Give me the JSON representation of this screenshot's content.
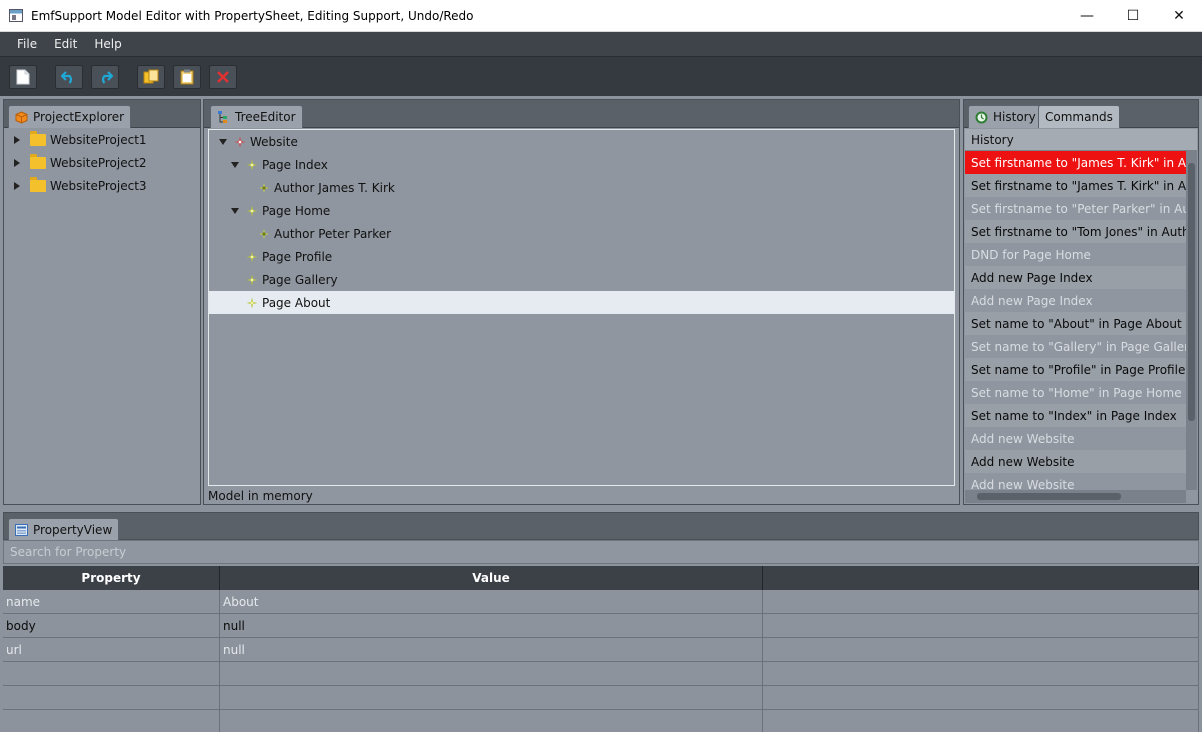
{
  "window": {
    "title": "EmfSupport Model Editor with PropertySheet, Editing Support, Undo/Redo",
    "controls": {
      "minimize": "—",
      "maximize": "☐",
      "close": "✕"
    }
  },
  "menu": [
    "File",
    "Edit",
    "Help"
  ],
  "toolbar": {
    "icons": [
      "new-file-icon",
      "undo-icon",
      "redo-icon",
      "copy-icon",
      "paste-icon",
      "delete-icon"
    ]
  },
  "project_explorer": {
    "tab": "ProjectExplorer",
    "items": [
      "WebsiteProject1",
      "WebsiteProject2",
      "WebsiteProject3"
    ]
  },
  "tree_editor": {
    "tab": "TreeEditor",
    "status": "Model in memory",
    "nodes": [
      {
        "label": "Website",
        "depth": 0,
        "expanded": true,
        "icon": "website-icon"
      },
      {
        "label": "Page Index",
        "depth": 1,
        "expanded": true,
        "icon": "page-icon"
      },
      {
        "label": "Author James T. Kirk",
        "depth": 2,
        "expanded": null,
        "icon": "author-icon"
      },
      {
        "label": "Page Home",
        "depth": 1,
        "expanded": true,
        "icon": "page-icon"
      },
      {
        "label": "Author Peter Parker",
        "depth": 2,
        "expanded": null,
        "icon": "author-icon"
      },
      {
        "label": "Page Profile",
        "depth": 1,
        "expanded": null,
        "icon": "page-icon"
      },
      {
        "label": "Page Gallery",
        "depth": 1,
        "expanded": null,
        "icon": "page-icon"
      },
      {
        "label": "Page About",
        "depth": 1,
        "expanded": null,
        "icon": "page-icon",
        "selected": true
      }
    ]
  },
  "history_panel": {
    "tabs": [
      "History",
      "Commands"
    ],
    "header": "History",
    "entries": [
      {
        "text": "Set firstname to \"James T. Kirk\" in Author James T. Kirk",
        "state": "current"
      },
      {
        "text": "Set firstname to \"James T. Kirk\" in Author Peter Parker",
        "state": "done"
      },
      {
        "text": "Set firstname to \"Peter Parker\" in Author Peter Parker",
        "state": "undone"
      },
      {
        "text": "Set firstname to \"Tom Jones\" in Author James T. Kirk",
        "state": "done"
      },
      {
        "text": "DND for Page Home",
        "state": "undone"
      },
      {
        "text": "Add new Page Index",
        "state": "done"
      },
      {
        "text": "Add new Page Index",
        "state": "undone"
      },
      {
        "text": "Set name to \"About\" in Page About",
        "state": "done"
      },
      {
        "text": "Set name to \"Gallery\" in Page Gallery",
        "state": "undone"
      },
      {
        "text": "Set name to \"Profile\" in Page Profile",
        "state": "done"
      },
      {
        "text": "Set name to \"Home\" in Page Home",
        "state": "undone"
      },
      {
        "text": "Set name to \"Index\" in Page Index",
        "state": "done"
      },
      {
        "text": "Add new Website",
        "state": "undone"
      },
      {
        "text": "Add new Website",
        "state": "done"
      },
      {
        "text": "Add new Website",
        "state": "undone"
      }
    ]
  },
  "property_view": {
    "tab": "PropertyView",
    "search_placeholder": "Search for  Property",
    "columns": [
      "Property",
      "Value",
      ""
    ],
    "rows": [
      {
        "property": "name",
        "value": "About",
        "style": "muted"
      },
      {
        "property": "body",
        "value": "null",
        "style": "strong"
      },
      {
        "property": "url",
        "value": "null",
        "style": "muted"
      },
      {
        "property": "",
        "value": "",
        "style": "muted"
      },
      {
        "property": "",
        "value": "",
        "style": "muted"
      },
      {
        "property": "",
        "value": "",
        "style": "muted"
      }
    ]
  },
  "colors": {
    "current_history": "#ee1111",
    "selected_row": "#e6ebf1",
    "dark_chrome": "#3f444b",
    "panel_bg": "#8f969f"
  }
}
